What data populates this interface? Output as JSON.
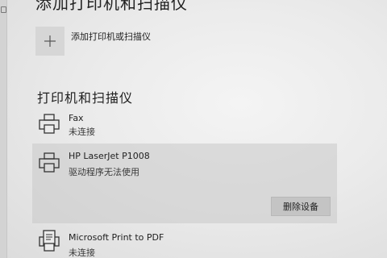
{
  "header": {
    "title": "添加打印机和扫描仪"
  },
  "add_device": {
    "icon": "plus-icon",
    "label": "添加打印机或扫描仪"
  },
  "printers_section": {
    "title": "打印机和扫描仪",
    "devices": [
      {
        "name": "Fax",
        "status": "未连接",
        "icon": "printer-icon"
      },
      {
        "name": "HP LaserJet P1008",
        "status": "驱动程序无法使用",
        "icon": "printer-icon",
        "selected": true,
        "action_label": "删除设备"
      },
      {
        "name": "Microsoft Print to PDF",
        "status": "未连接",
        "icon": "pdf-printer-icon"
      }
    ]
  },
  "colors": {
    "background": "#e9e9e9",
    "selected_row": "#d4d4d4",
    "button": "#c4c4c4",
    "text": "#1f1f1f"
  }
}
